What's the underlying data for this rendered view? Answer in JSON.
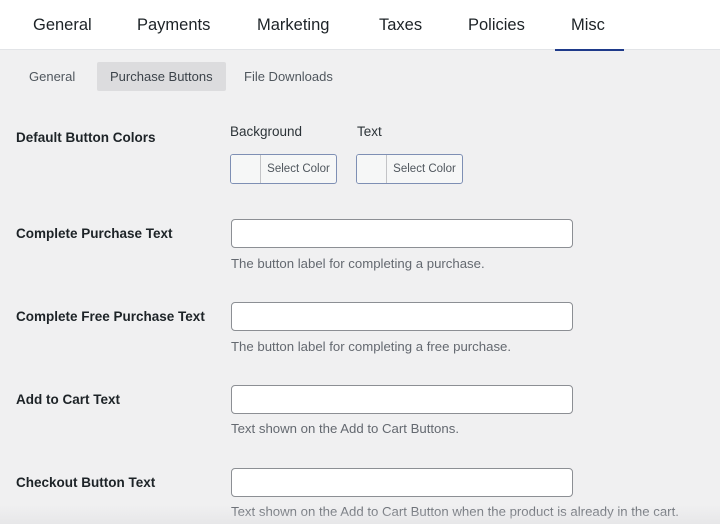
{
  "top_tabs": [
    {
      "label": "General",
      "active": false
    },
    {
      "label": "Payments",
      "active": false
    },
    {
      "label": "Marketing",
      "active": false
    },
    {
      "label": "Taxes",
      "active": false
    },
    {
      "label": "Policies",
      "active": false
    },
    {
      "label": "Misc",
      "active": true
    }
  ],
  "sub_tabs": [
    {
      "label": "General",
      "active": false
    },
    {
      "label": "Purchase Buttons",
      "active": true
    },
    {
      "label": "File Downloads",
      "active": false
    }
  ],
  "settings": {
    "button_colors": {
      "label": "Default Button Colors",
      "background": {
        "label": "Background",
        "button_label": "Select Color"
      },
      "text": {
        "label": "Text",
        "button_label": "Select Color"
      }
    },
    "complete_purchase": {
      "label": "Complete Purchase Text",
      "value": "",
      "description": "The button label for completing a purchase."
    },
    "complete_free_purchase": {
      "label": "Complete Free Purchase Text",
      "value": "",
      "description": "The button label for completing a free purchase."
    },
    "add_to_cart": {
      "label": "Add to Cart Text",
      "value": "",
      "description": "Text shown on the Add to Cart Buttons."
    },
    "checkout_button": {
      "label": "Checkout Button Text",
      "value": "",
      "description": "Text shown on the Add to Cart Button when the product is already in the cart."
    }
  },
  "colors": {
    "active_tab_underline": "#1e3a8a",
    "active_subtab_bg": "#dcdcde",
    "page_bg": "#f0f0f1"
  }
}
